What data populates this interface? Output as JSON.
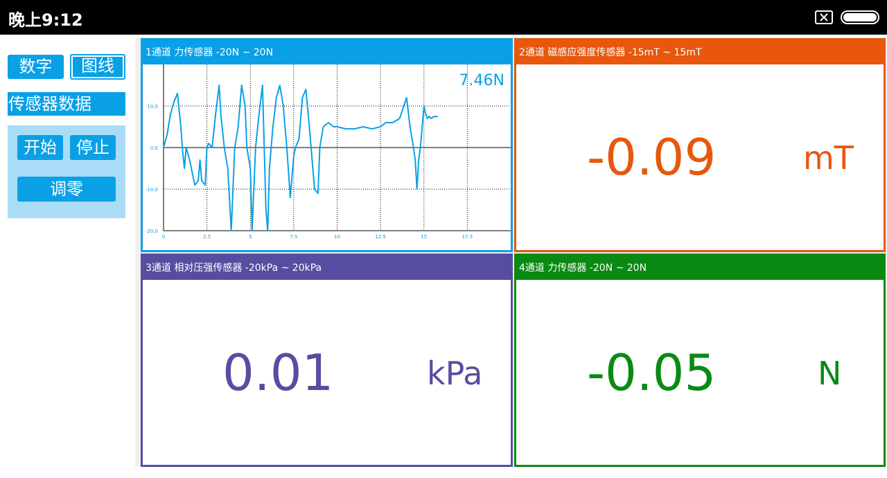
{
  "status": {
    "time": "晚上9:12"
  },
  "sidebar": {
    "digit_label": "数字",
    "graph_label": "图线",
    "section_title": "传感器数据",
    "start_label": "开始",
    "stop_label": "停止",
    "zero_label": "调零"
  },
  "channels": [
    {
      "header": "1通道 力传感器 -20N ~ 20N",
      "value": "7.46N",
      "color": "#0aa0e6"
    },
    {
      "header": "2通道 磁感应强度传感器 -15mT ~ 15mT",
      "value": "-0.09",
      "unit": "mT",
      "color": "#e8570c"
    },
    {
      "header": "3通道 相对压强传感器 -20kPa ~ 20kPa",
      "value": "0.01",
      "unit": "kPa",
      "color": "#574da0"
    },
    {
      "header": "4通道 力传感器 -20N ~ 20N",
      "value": "-0.05",
      "unit": "N",
      "color": "#0a8a12"
    }
  ],
  "chart_data": {
    "type": "line",
    "xlim": [
      0,
      20
    ],
    "ylim": [
      -20,
      20
    ],
    "x_ticks": [
      "0",
      "2.5",
      "5",
      "7.5",
      "10",
      "12.5",
      "15",
      "17.5"
    ],
    "x_tick_values": [
      0,
      2.5,
      5,
      7.5,
      10,
      12.5,
      15,
      17.5
    ],
    "y_ticks": [
      "10.0",
      "0.0",
      "-10.0",
      "-20.0"
    ],
    "y_tick_values": [
      10,
      0,
      -10,
      -20
    ],
    "grid": true,
    "series": [
      {
        "color": "#0aa0e6",
        "x": [
          0,
          0.2,
          0.4,
          0.6,
          0.8,
          1.0,
          1.1,
          1.2,
          1.3,
          1.5,
          1.8,
          2.0,
          2.1,
          2.2,
          2.4,
          2.5,
          2.6,
          2.8,
          3.0,
          3.2,
          3.3,
          3.5,
          3.7,
          3.9,
          4.1,
          4.3,
          4.5,
          4.7,
          4.8,
          5.0,
          5.1,
          5.3,
          5.5,
          5.7,
          5.8,
          5.9,
          6.0,
          6.1,
          6.3,
          6.5,
          6.7,
          6.9,
          7.1,
          7.3,
          7.5,
          7.6,
          7.8,
          8.0,
          8.2,
          8.4,
          8.5,
          8.7,
          8.9,
          9.0,
          9.2,
          9.5,
          9.8,
          10.0,
          10.5,
          11.0,
          11.5,
          12.0,
          12.5,
          12.8,
          13.2,
          13.6,
          14.0,
          14.2,
          14.4,
          14.5,
          14.6,
          14.7,
          14.8,
          14.9,
          15.0,
          15.1,
          15.2,
          15.3,
          15.4,
          15.6,
          15.8
        ],
        "y": [
          0,
          3,
          8,
          11,
          13,
          5,
          -1,
          -5,
          0,
          -3,
          -9,
          -8,
          -3,
          -8,
          -9,
          0,
          1,
          0,
          8,
          15,
          8,
          0,
          -5,
          -20,
          0,
          5,
          15,
          10,
          0,
          -5,
          -20,
          0,
          8,
          15,
          0,
          -15,
          -20,
          -5,
          5,
          12,
          15,
          10,
          0,
          -12,
          -2,
          0,
          2,
          12,
          14,
          5,
          0,
          -10,
          -11,
          0,
          5,
          6,
          5,
          5,
          4.5,
          4.5,
          5,
          4.5,
          5,
          6,
          6,
          7,
          12,
          5,
          0,
          -3,
          -10,
          -3,
          0,
          5,
          10,
          8,
          7,
          7.5,
          7,
          7.5,
          7.46
        ]
      }
    ]
  }
}
